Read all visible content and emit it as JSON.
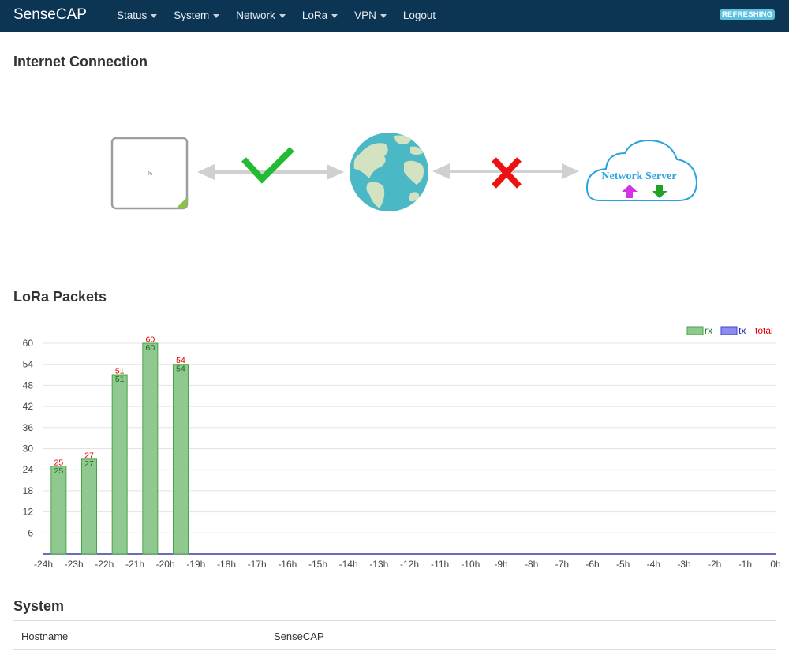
{
  "navbar": {
    "brand": "SenseCAP",
    "items": [
      {
        "label": "Status",
        "dropdown": true
      },
      {
        "label": "System",
        "dropdown": true
      },
      {
        "label": "Network",
        "dropdown": true
      },
      {
        "label": "LoRa",
        "dropdown": true
      },
      {
        "label": "VPN",
        "dropdown": true
      },
      {
        "label": "Logout",
        "dropdown": false
      }
    ],
    "status_badge": "REFRESHING"
  },
  "internet_connection": {
    "title": "Internet Connection",
    "gateway_to_internet": "connected",
    "internet_to_server": "disconnected",
    "server_label": "Network Server",
    "colors": {
      "ok": "#22bb33",
      "fail": "#ee1111",
      "arrow": "#d0d0d0",
      "globe_ocean": "#4bb8c6",
      "globe_land": "#d3e3c2",
      "cloud": "#29a3e0",
      "upload": "#d633e6",
      "download": "#23a127"
    }
  },
  "lora_packets": {
    "title": "LoRa Packets"
  },
  "chart_data": {
    "type": "bar",
    "categories": [
      "-24h",
      "-23h",
      "-22h",
      "-21h",
      "-20h",
      "-19h",
      "-18h",
      "-17h",
      "-16h",
      "-15h",
      "-14h",
      "-13h",
      "-12h",
      "-11h",
      "-10h",
      "-9h",
      "-8h",
      "-7h",
      "-6h",
      "-5h",
      "-4h",
      "-3h",
      "-2h",
      "-1h",
      "0h"
    ],
    "series": [
      {
        "name": "rx",
        "values": [
          25,
          27,
          51,
          60,
          54,
          0,
          0,
          0,
          0,
          0,
          0,
          0,
          0,
          0,
          0,
          0,
          0,
          0,
          0,
          0,
          0,
          0,
          0,
          0
        ],
        "color": "#8fc98f"
      },
      {
        "name": "tx",
        "values": [
          0,
          0,
          0,
          0,
          0,
          0,
          0,
          0,
          0,
          0,
          0,
          0,
          0,
          0,
          0,
          0,
          0,
          0,
          0,
          0,
          0,
          0,
          0,
          0
        ],
        "color": "#8c8cef"
      },
      {
        "name": "total",
        "values": [
          25,
          27,
          51,
          60,
          54,
          0,
          0,
          0,
          0,
          0,
          0,
          0,
          0,
          0,
          0,
          0,
          0,
          0,
          0,
          0,
          0,
          0,
          0,
          0
        ],
        "color": "#e00000"
      }
    ],
    "yticks": [
      6,
      12,
      18,
      24,
      30,
      36,
      42,
      48,
      54,
      60
    ],
    "ylim": [
      0,
      60
    ],
    "grid": true,
    "legend": "top-right"
  },
  "system": {
    "title": "System",
    "rows": [
      {
        "key": "Hostname",
        "value": "SenseCAP"
      }
    ]
  }
}
